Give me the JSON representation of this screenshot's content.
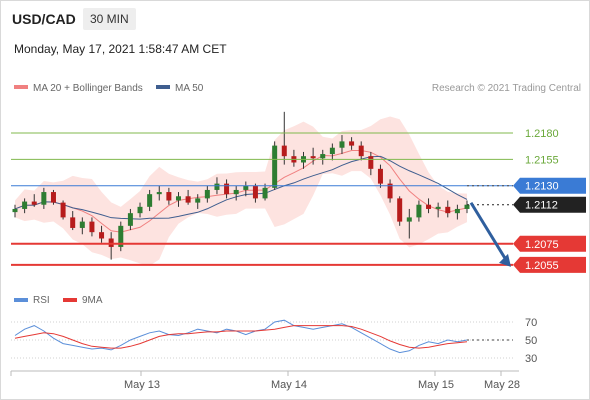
{
  "header": {
    "symbol": "USD/CAD",
    "timeframe": "30 MIN",
    "datetime": "Monday, May 17, 2021 1:58:47 AM CET"
  },
  "legend": {
    "ma20": "MA 20 + Bollinger Bands",
    "ma50": "MA 50",
    "copyright": "Research © 2021 Trading Central"
  },
  "rsi_legend": {
    "rsi": "RSI",
    "ma9": "9MA"
  },
  "colors": {
    "candle_up": "#2e7d32",
    "candle_down": "#b71c1c",
    "bollinger_fill": "#fde3e0",
    "ma20": "#f08080",
    "ma50": "#3f5e8f",
    "resistance": "#80b84d",
    "current": "#3a7bd5",
    "support": "#e53935",
    "price_tag": "#222222",
    "arrow": "#2f5f9e",
    "rsi": "#5b8fd9",
    "rsi_ma": "#e53935"
  },
  "chart_data": {
    "type": "candlestick",
    "y_range": [
      1.2035,
      1.2215
    ],
    "levels": [
      {
        "label": "1.2180",
        "value": 1.218,
        "kind": "resistance"
      },
      {
        "label": "1.2155",
        "value": 1.2155,
        "kind": "resistance"
      },
      {
        "label": "1.2130",
        "value": 1.213,
        "kind": "pivot"
      },
      {
        "label": "1.2112",
        "value": 1.2112,
        "kind": "last"
      },
      {
        "label": "1.2075",
        "value": 1.2075,
        "kind": "support"
      },
      {
        "label": "1.2055",
        "value": 1.2055,
        "kind": "support"
      }
    ],
    "x_labels": [
      "May 13",
      "May 14",
      "May 15",
      "May 28"
    ],
    "forecast_arrow": {
      "from": 1.2112,
      "to": 1.2055
    },
    "ohlc_approx": [
      [
        1.2105,
        1.2112,
        1.21,
        1.2108
      ],
      [
        1.2108,
        1.2118,
        1.2104,
        1.2115
      ],
      [
        1.2115,
        1.2122,
        1.211,
        1.2112
      ],
      [
        1.2112,
        1.2128,
        1.2108,
        1.2124
      ],
      [
        1.2124,
        1.2126,
        1.2112,
        1.2114
      ],
      [
        1.2114,
        1.2116,
        1.2098,
        1.21
      ],
      [
        1.21,
        1.2106,
        1.2088,
        1.209
      ],
      [
        1.209,
        1.21,
        1.2084,
        1.2096
      ],
      [
        1.2096,
        1.21,
        1.2082,
        1.2086
      ],
      [
        1.2086,
        1.2092,
        1.2076,
        1.208
      ],
      [
        1.208,
        1.2086,
        1.206,
        1.2072
      ],
      [
        1.2072,
        1.2096,
        1.2068,
        1.2092
      ],
      [
        1.2092,
        1.2108,
        1.2088,
        1.2104
      ],
      [
        1.2104,
        1.2114,
        1.21,
        1.211
      ],
      [
        1.211,
        1.2126,
        1.2106,
        1.2122
      ],
      [
        1.2122,
        1.213,
        1.2116,
        1.2124
      ],
      [
        1.2124,
        1.2128,
        1.2112,
        1.2116
      ],
      [
        1.2116,
        1.2124,
        1.211,
        1.212
      ],
      [
        1.212,
        1.2126,
        1.2112,
        1.2114
      ],
      [
        1.2114,
        1.2122,
        1.2108,
        1.2118
      ],
      [
        1.2118,
        1.213,
        1.2114,
        1.2126
      ],
      [
        1.2126,
        1.2138,
        1.2122,
        1.2132
      ],
      [
        1.2132,
        1.2136,
        1.2118,
        1.2122
      ],
      [
        1.2122,
        1.213,
        1.2116,
        1.2126
      ],
      [
        1.2126,
        1.2134,
        1.212,
        1.213
      ],
      [
        1.213,
        1.2132,
        1.2114,
        1.2118
      ],
      [
        1.2118,
        1.2132,
        1.2116,
        1.2128
      ],
      [
        1.2128,
        1.2172,
        1.2126,
        1.2168
      ],
      [
        1.2168,
        1.22,
        1.215,
        1.2158
      ],
      [
        1.2158,
        1.2164,
        1.2148,
        1.2152
      ],
      [
        1.2152,
        1.2162,
        1.2146,
        1.2158
      ],
      [
        1.2158,
        1.2166,
        1.215,
        1.2156
      ],
      [
        1.2156,
        1.2164,
        1.215,
        1.216
      ],
      [
        1.216,
        1.217,
        1.2154,
        1.2166
      ],
      [
        1.2166,
        1.2178,
        1.216,
        1.2172
      ],
      [
        1.2172,
        1.2176,
        1.2164,
        1.2168
      ],
      [
        1.2168,
        1.2172,
        1.2154,
        1.2158
      ],
      [
        1.2158,
        1.2162,
        1.214,
        1.2146
      ],
      [
        1.2146,
        1.215,
        1.2128,
        1.2132
      ],
      [
        1.2132,
        1.2136,
        1.2114,
        1.2118
      ],
      [
        1.2118,
        1.212,
        1.2092,
        1.2096
      ],
      [
        1.2096,
        1.2108,
        1.208,
        1.21
      ],
      [
        1.21,
        1.2116,
        1.2096,
        1.2112
      ],
      [
        1.2112,
        1.2118,
        1.2104,
        1.2108
      ],
      [
        1.2108,
        1.2114,
        1.21,
        1.211
      ],
      [
        1.211,
        1.2116,
        1.21,
        1.2104
      ],
      [
        1.2104,
        1.2112,
        1.2098,
        1.2108
      ],
      [
        1.2108,
        1.2116,
        1.2104,
        1.2112
      ]
    ]
  },
  "rsi_data": {
    "axis_labels": [
      "70",
      "50",
      "30"
    ],
    "rsi": [
      55,
      62,
      66,
      60,
      52,
      46,
      44,
      42,
      40,
      41,
      39,
      44,
      50,
      54,
      58,
      60,
      56,
      55,
      58,
      62,
      60,
      58,
      62,
      60,
      56,
      60,
      62,
      70,
      72,
      66,
      64,
      62,
      64,
      66,
      68,
      64,
      58,
      52,
      46,
      40,
      36,
      38,
      44,
      48,
      46,
      50,
      48,
      50
    ],
    "ma9": [
      52,
      54,
      56,
      58,
      57,
      54,
      50,
      46,
      43,
      42,
      41,
      41,
      43,
      46,
      50,
      54,
      56,
      57,
      57,
      58,
      59,
      59,
      60,
      60,
      60,
      60,
      61,
      62,
      64,
      66,
      66,
      66,
      66,
      66,
      66,
      65,
      62,
      58,
      54,
      49,
      45,
      42,
      41,
      42,
      44,
      46,
      47,
      48
    ]
  }
}
